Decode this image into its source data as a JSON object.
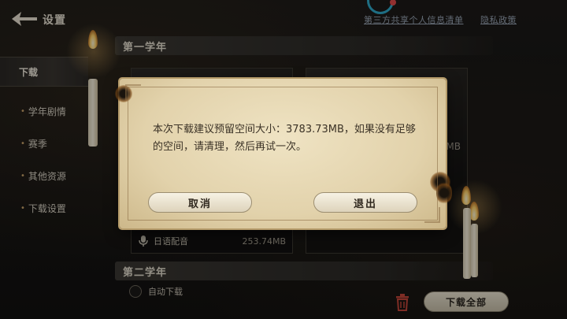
{
  "header": {
    "title": "设置",
    "links": [
      "第三方共享个人信息清单",
      "隐私政策"
    ]
  },
  "sidebar": {
    "items": [
      {
        "label": "下载",
        "active": true
      },
      {
        "label": "学年剧情",
        "active": false
      },
      {
        "label": "赛季",
        "active": false
      },
      {
        "label": "其他资源",
        "active": false
      },
      {
        "label": "下载设置",
        "active": false
      }
    ]
  },
  "main": {
    "section_1": "第一学年",
    "section_2": "第二学年",
    "card_1": {
      "label": "日语配音",
      "size": "253.74MB"
    },
    "card_2": {
      "size_partial": "5MB"
    },
    "auto_download": "自动下载",
    "download_all": "下载全部"
  },
  "dialog": {
    "message": "本次下载建议预留空间大小：3783.73MB，如果没有足够的空间，请清理，然后再试一次。",
    "cancel": "取消",
    "exit": "退出"
  },
  "colors": {
    "accent_teal": "#2fa9c9",
    "accent_red": "#e14b4b",
    "parchment": "#e2d2ab"
  }
}
